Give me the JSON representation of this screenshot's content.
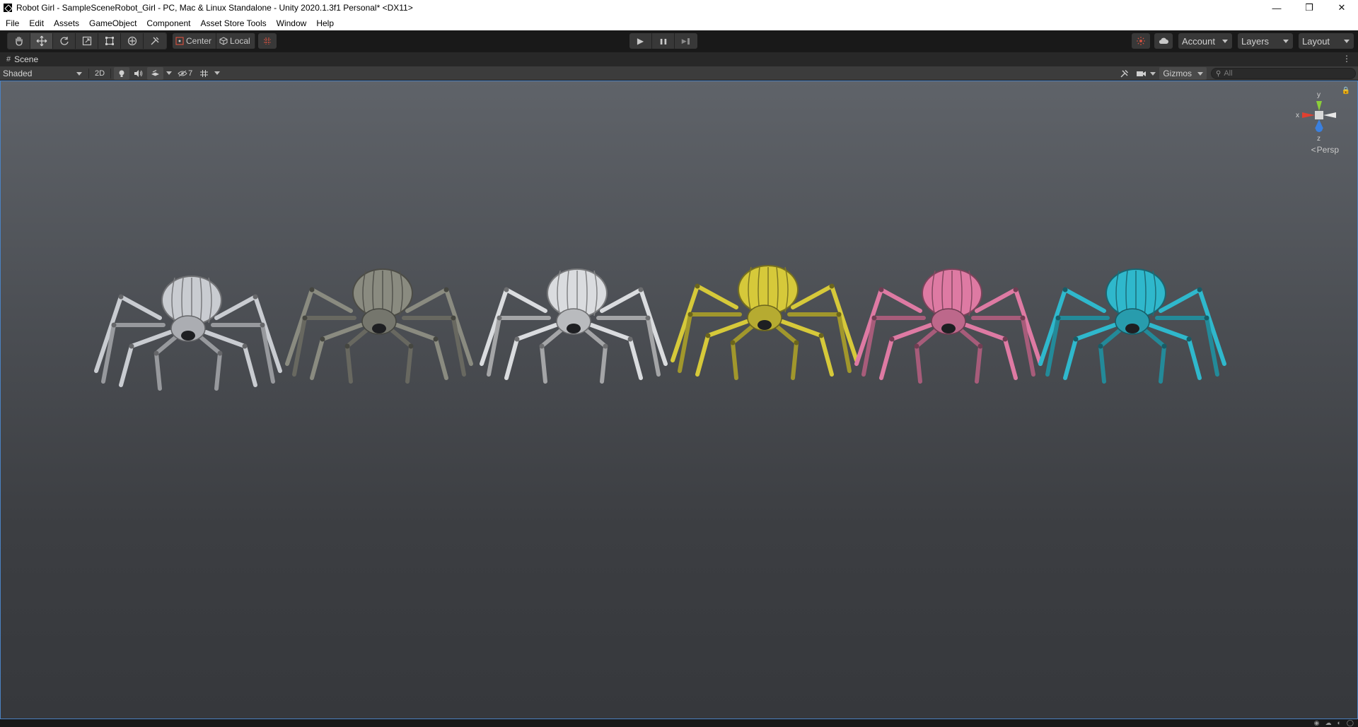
{
  "window": {
    "title": "Robot Girl - SampleSceneRobot_Girl - PC, Mac & Linux Standalone - Unity 2020.1.3f1 Personal* <DX11>",
    "minimize_glyph": "—",
    "restore_glyph": "❒",
    "close_glyph": "✕"
  },
  "menu": {
    "items": [
      "File",
      "Edit",
      "Assets",
      "GameObject",
      "Component",
      "Asset Store Tools",
      "Window",
      "Help"
    ]
  },
  "toolbar": {
    "tools": [
      "hand-icon",
      "move-icon",
      "rotate-icon",
      "scale-icon",
      "rect-icon",
      "transform-icon",
      "custom-tool-icon"
    ],
    "active_tool": "move-icon",
    "pivot_label": "Center",
    "rotation_label": "Local",
    "play_glyph": "▶",
    "pause_glyph": "❚❚",
    "step_glyph": "▶❚",
    "account_label": "Account",
    "layers_label": "Layers",
    "layout_label": "Layout"
  },
  "scene": {
    "tab_label": "Scene",
    "shading_mode": "Shaded",
    "mode_2d_label": "2D",
    "hidden_count": "7",
    "gizmos_label": "Gizmos",
    "search_placeholder": "All",
    "projection_label": "Persp",
    "axis_labels": {
      "x": "x",
      "y": "y",
      "z": "z"
    }
  },
  "spiders": {
    "colors": [
      "#c9ccd1",
      "#8a8b80",
      "#dadcdf",
      "#d6c93a",
      "#de7aa3",
      "#2fb8cc"
    ],
    "names": [
      "white-red-blue-spider",
      "grey-green-spider",
      "white-silver-spider",
      "yellow-spider",
      "pink-spider",
      "cyan-spider"
    ]
  },
  "accent": {
    "viewport_border": "#4b82c2",
    "axis_x": "#e04030",
    "axis_y": "#8ccf3a",
    "axis_z": "#3a80e0"
  }
}
